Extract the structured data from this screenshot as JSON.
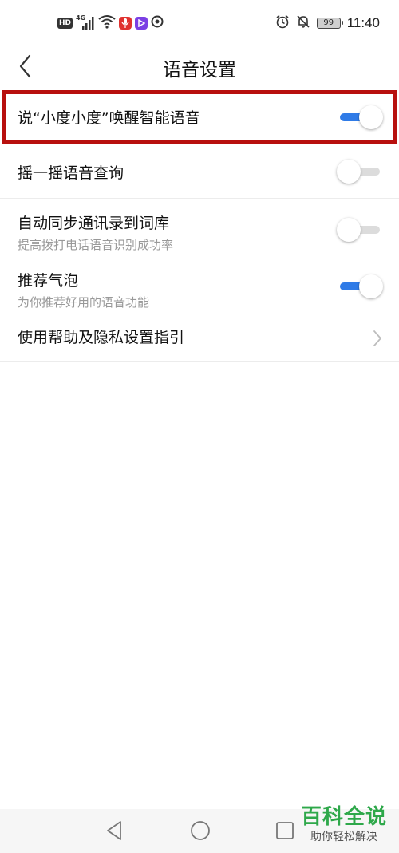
{
  "status_bar": {
    "hd_label": "HD",
    "network_label": "4G",
    "battery_level": "99",
    "time": "11:40",
    "icons": [
      "hd-icon",
      "signal-icon",
      "wifi-icon",
      "mic-app-icon",
      "video-app-icon",
      "app-icon",
      "alarm-icon",
      "mute-bell-icon",
      "battery-icon"
    ]
  },
  "header": {
    "title": "语音设置",
    "back_icon": "chevron-left-icon"
  },
  "settings": [
    {
      "id": "wake",
      "label": "说“小度小度”唤醒智能语音",
      "subtitle": null,
      "control": "toggle",
      "enabled": true,
      "highlighted": true
    },
    {
      "id": "shake",
      "label": "摇一摇语音查询",
      "subtitle": null,
      "control": "toggle",
      "enabled": false
    },
    {
      "id": "contacts",
      "label": "自动同步通讯录到词库",
      "subtitle": "提高拨打电话语音识别成功率",
      "control": "toggle",
      "enabled": false
    },
    {
      "id": "bubble",
      "label": "推荐气泡",
      "subtitle": "为你推荐好用的语音功能",
      "control": "toggle",
      "enabled": true
    },
    {
      "id": "help",
      "label": "使用帮助及隐私设置指引",
      "subtitle": null,
      "control": "chevron",
      "icon": "chevron-right-icon"
    }
  ],
  "colors": {
    "toggle_on": "#2f7be7",
    "toggle_off": "#dcdcdc",
    "highlight_border": "#b8100e",
    "watermark_green": "#2ea84a"
  },
  "system_nav": {
    "icons": [
      "back-triangle-icon",
      "home-circle-icon",
      "recents-square-icon"
    ]
  },
  "watermark": {
    "title": "百科全说",
    "subtitle": "助你轻松解决"
  }
}
